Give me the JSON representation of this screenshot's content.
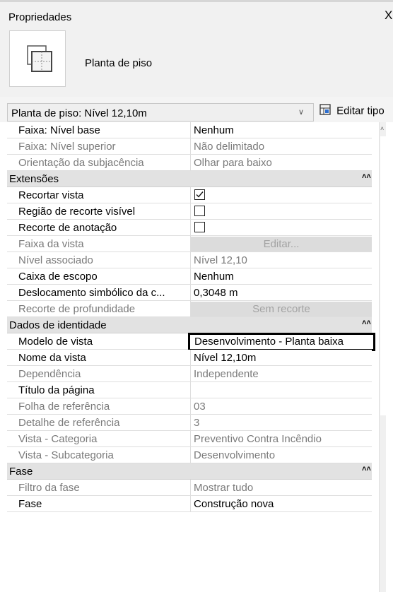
{
  "panel": {
    "title": "Propriedades",
    "close_glyph": "X"
  },
  "preview": {
    "type_name": "Planta de piso",
    "icon": "floor-plan-icon"
  },
  "type_selector": {
    "value": "Planta de piso: Nível 12,10m",
    "edit_type_label": "Editar tipo"
  },
  "rows": [
    {
      "name": "Faixa: Nível base",
      "value": "Nenhum"
    },
    {
      "name": "Faixa: Nível superior",
      "value": "Não delimitado"
    },
    {
      "name": "Orientação da subjacência",
      "value": "Olhar para baixo"
    },
    {
      "section": "Extensões"
    },
    {
      "name": "Recortar vista",
      "checked": true
    },
    {
      "name": "Região de recorte visível",
      "checked": false
    },
    {
      "name": "Recorte de anotação",
      "checked": false
    },
    {
      "name": "Faixa da vista",
      "button": "Editar..."
    },
    {
      "name": "Nível associado",
      "value": "Nível 12,10"
    },
    {
      "name": "Caixa de escopo",
      "value": "Nenhum"
    },
    {
      "name": "Deslocamento simbólico da c...",
      "value": "0,3048 m"
    },
    {
      "name": "Recorte de profundidade",
      "button": "Sem recorte"
    },
    {
      "section": "Dados de identidade"
    },
    {
      "name": "Modelo de vista",
      "value": "Desenvolvimento - Planta baixa"
    },
    {
      "name": "Nome da vista",
      "value": "Nível 12,10m"
    },
    {
      "name": "Dependência",
      "value": "Independente"
    },
    {
      "name": "Título da página",
      "value": ""
    },
    {
      "name": "Folha de referência",
      "value": "03"
    },
    {
      "name": "Detalhe de referência",
      "value": "3"
    },
    {
      "name": "Vista - Categoria",
      "value": "Preventivo Contra Incêndio"
    },
    {
      "name": "Vista - Subcategoria",
      "value": "Desenvolvimento"
    },
    {
      "section": "Fase"
    },
    {
      "name": "Filtro da fase",
      "value": "Mostrar tudo"
    },
    {
      "name": "Fase",
      "value": "Construção nova"
    }
  ]
}
